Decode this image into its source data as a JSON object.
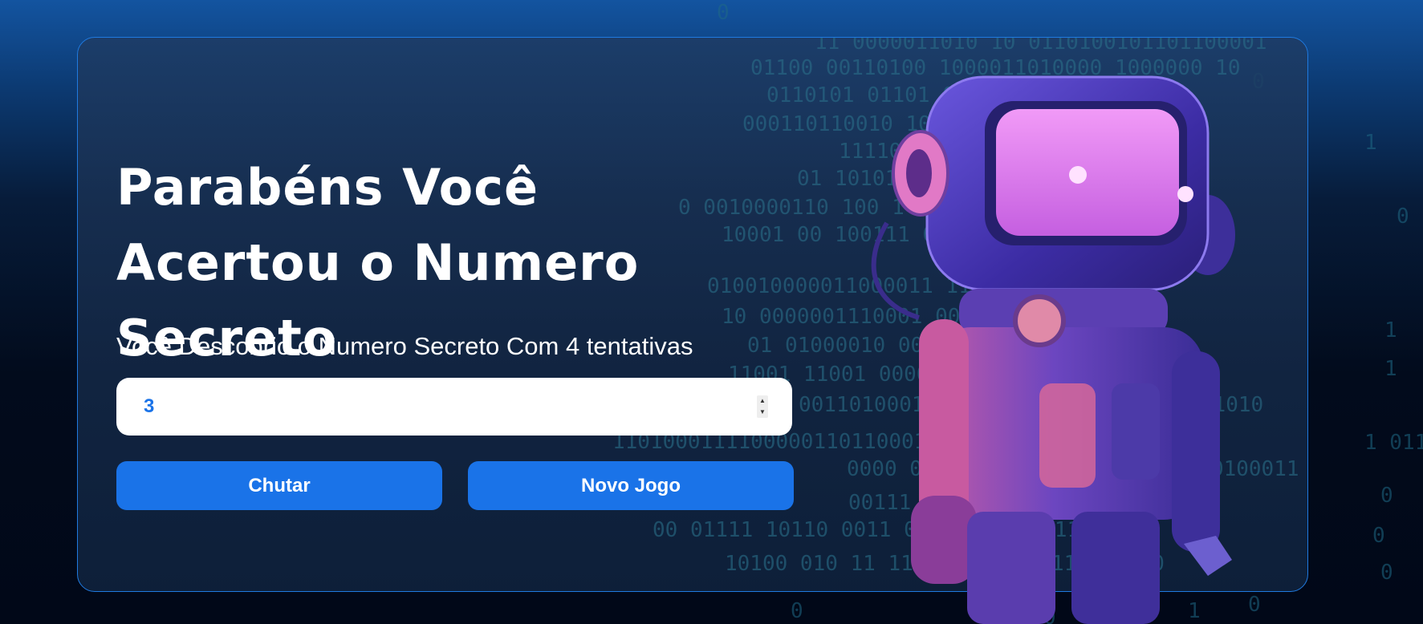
{
  "title": "Parabéns Você Acertou o Numero Secreto",
  "subtitle": "Você Descobrio o Numero Secreto Com 4 tentativas",
  "guess_input": {
    "value": "3"
  },
  "buttons": {
    "kick_label": "Chutar",
    "new_game_label": "Novo Jogo"
  },
  "colors": {
    "accent": "#1a73e8",
    "robot_visor": "#e27df0",
    "robot_suit": "#4a37b8"
  },
  "background": {
    "binary_rows": [
      "0",
      "11 0000011010 10 0110100101101100001",
      "01100 00110100 100001101000 11 10",
      "0110101 0110 0110 1111011 1 0",
      "000110110010 1011 10101 011101000010",
      "0 1111111010 1011 0010101 1011 00",
      "01 1010100 10 000000011 001011",
      "0 0010000110 100 1 0 1 010 101 1 0",
      "10001 00 100111 011000 00001010101",
      "010010000011000011 110 0 00100011",
      "10 0000001110001 0000101 1 0",
      "1101 01000010 0011001 00011111 01000",
      "11001 11001 0000 001111 0101101000110",
      "0011010001 1000 1010011111011000 1010",
      "1101000111100000110110001001 000 111 0",
      "0000 00010 000 100100 00111110100011 0",
      "00111 0011 0 00 00",
      "00 01111 10110 0011 00011 01 11011",
      "10100 010 11 110 0010 0110110 01000",
      "1 0 1 0"
    ]
  }
}
